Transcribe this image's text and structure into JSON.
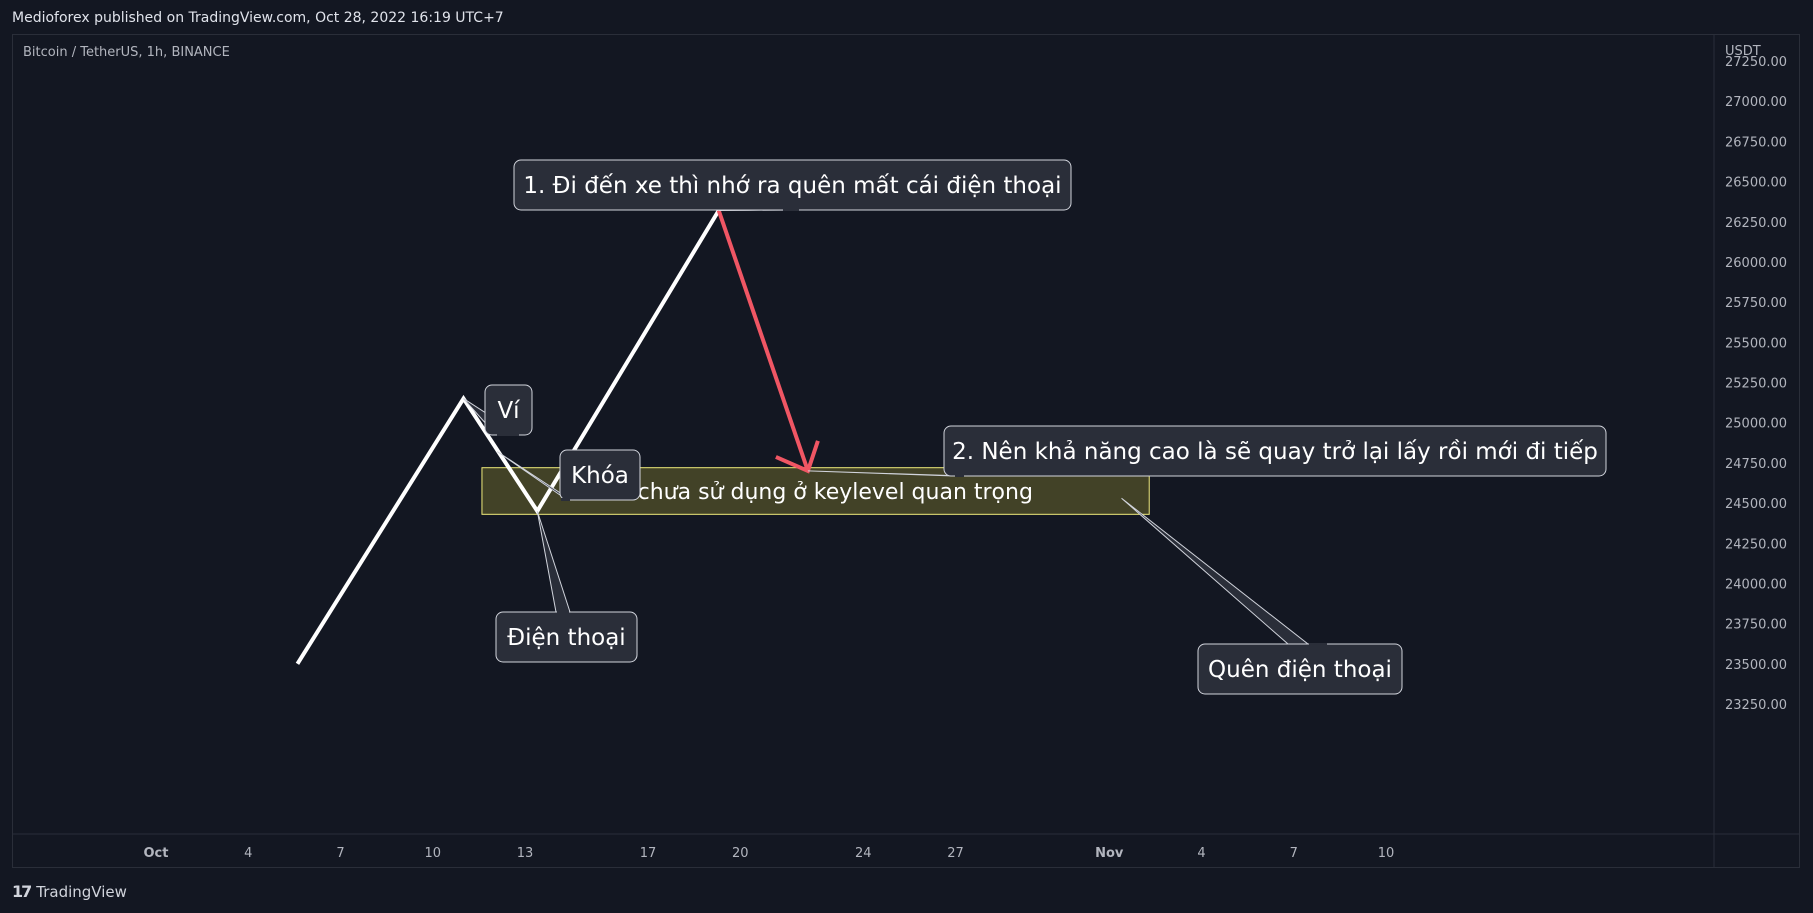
{
  "header": {
    "published_text": "Medioforex published on TradingView.com, Oct 28, 2022 16:19 UTC+7"
  },
  "symbol": {
    "text": "Bitcoin / TetherUS, 1h, BINANCE"
  },
  "footer": {
    "logo_text": "TradingView",
    "logo_mark": "17"
  },
  "colors": {
    "background": "#131722",
    "up_path": "#ffffff",
    "down_path": "#f05664",
    "zone_fill": "#4b4a28",
    "zone_border": "#f0eb7a",
    "callout_fill": "#2a2e39",
    "callout_border": "#d1d4dc"
  },
  "chart_data": {
    "type": "line",
    "y_axis": {
      "currency": "USDT",
      "ticks": [
        "27250.00",
        "27000.00",
        "26750.00",
        "26500.00",
        "26250.00",
        "26000.00",
        "25750.00",
        "25500.00",
        "25250.00",
        "25000.00",
        "24750.00",
        "24500.00",
        "24250.00",
        "24000.00",
        "23750.00",
        "23500.00",
        "23250.00"
      ],
      "ylim": [
        23150,
        27350
      ]
    },
    "x_axis": {
      "ticks": [
        {
          "day": 0,
          "label": "Oct"
        },
        {
          "day": 3,
          "label": "4"
        },
        {
          "day": 6,
          "label": "7"
        },
        {
          "day": 9,
          "label": "10"
        },
        {
          "day": 12,
          "label": "13"
        },
        {
          "day": 16,
          "label": "17"
        },
        {
          "day": 19,
          "label": "20"
        },
        {
          "day": 23,
          "label": "24"
        },
        {
          "day": 26,
          "label": "27"
        },
        {
          "day": 31,
          "label": "Nov"
        },
        {
          "day": 34,
          "label": "4"
        },
        {
          "day": 37,
          "label": "7"
        },
        {
          "day": 40,
          "label": "10"
        }
      ]
    },
    "up_path": {
      "points": [
        {
          "day": 4.6,
          "price": 23500
        },
        {
          "day": 10.0,
          "price": 25150
        },
        {
          "day": 12.4,
          "price": 24450
        },
        {
          "day": 18.3,
          "price": 26320
        }
      ]
    },
    "down_path": {
      "points": [
        {
          "day": 18.3,
          "price": 26320
        },
        {
          "day": 21.2,
          "price": 24700
        }
      ]
    },
    "zone": {
      "label": "OB chưa sử dụng ở keylevel quan trọng",
      "day_from": 10.6,
      "day_to": 32.3,
      "price_top": 24720,
      "price_bottom": 24430
    },
    "annotations": [
      {
        "text": "1. Đi đến xe thì nhớ ra quên mất cái điện thoại",
        "day": 18.3,
        "price": 26320
      },
      {
        "text": "2. Nên khả năng cao là sẽ quay trở lại lấy rồi mới đi tiếp",
        "day": 21.2,
        "price": 24700
      },
      {
        "text": "Ví",
        "day": 10.0,
        "price": 25150
      },
      {
        "text": "Khóa",
        "day": 11.1,
        "price": 24820
      },
      {
        "text": "Điện thoại",
        "day": 12.4,
        "price": 24450
      },
      {
        "text": "Quên điện thoại",
        "day": 31.4,
        "price": 24530
      }
    ]
  }
}
